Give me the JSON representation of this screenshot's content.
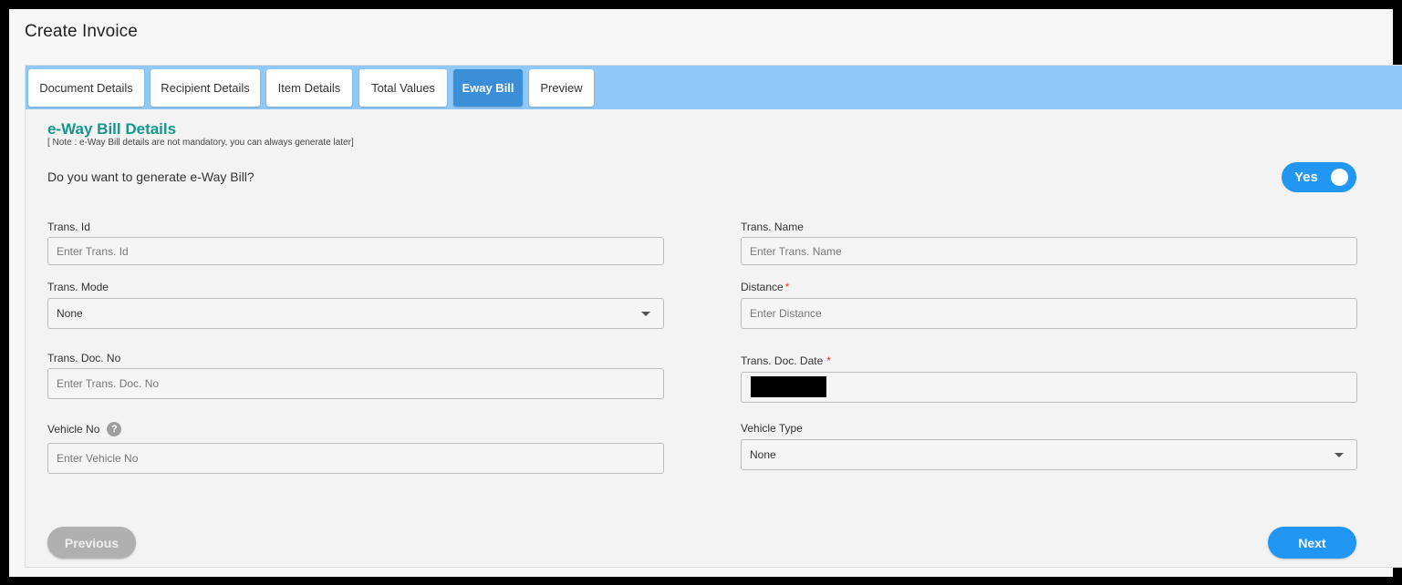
{
  "page": {
    "title": "Create Invoice"
  },
  "tabs": [
    {
      "label": "Document Details"
    },
    {
      "label": "Recipient Details"
    },
    {
      "label": "Item Details"
    },
    {
      "label": "Total Values"
    },
    {
      "label": "Eway Bill"
    },
    {
      "label": "Preview"
    }
  ],
  "active_tab": "Eway Bill",
  "section": {
    "title": "e-Way Bill Details",
    "note": "[ Note : e-Way Bill details are not mandatory, you can always generate later]",
    "question": "Do you want to generate e-Way Bill?"
  },
  "toggle": {
    "label": "Yes",
    "checked": true
  },
  "fields": {
    "trans_id": {
      "label": "Trans. Id",
      "placeholder": "Enter Trans. Id",
      "value": ""
    },
    "trans_name": {
      "label": "Trans. Name",
      "placeholder": "Enter Trans. Name",
      "value": ""
    },
    "trans_mode": {
      "label": "Trans. Mode",
      "selected": "None"
    },
    "distance": {
      "label": "Distance",
      "required_mark": "*",
      "placeholder": "Enter Distance",
      "value": ""
    },
    "trans_doc_no": {
      "label": "Trans. Doc. No",
      "placeholder": "Enter Trans. Doc. No",
      "value": ""
    },
    "trans_doc_date": {
      "label": "Trans. Doc. Date",
      "required_mark": "*",
      "value_redacted": true
    },
    "vehicle_no": {
      "label": "Vehicle No",
      "help_glyph": "?",
      "placeholder": "Enter Vehicle No",
      "value": ""
    },
    "vehicle_type": {
      "label": "Vehicle Type",
      "selected": "None"
    }
  },
  "buttons": {
    "previous": "Previous",
    "next": "Next"
  },
  "colors": {
    "tabbar": "#90c9f8",
    "active_tab": "#3a8fd8",
    "section_title": "#14958e",
    "primary": "#2196f3",
    "disabled_button": "#b0b0b0",
    "required": "#e53935"
  }
}
